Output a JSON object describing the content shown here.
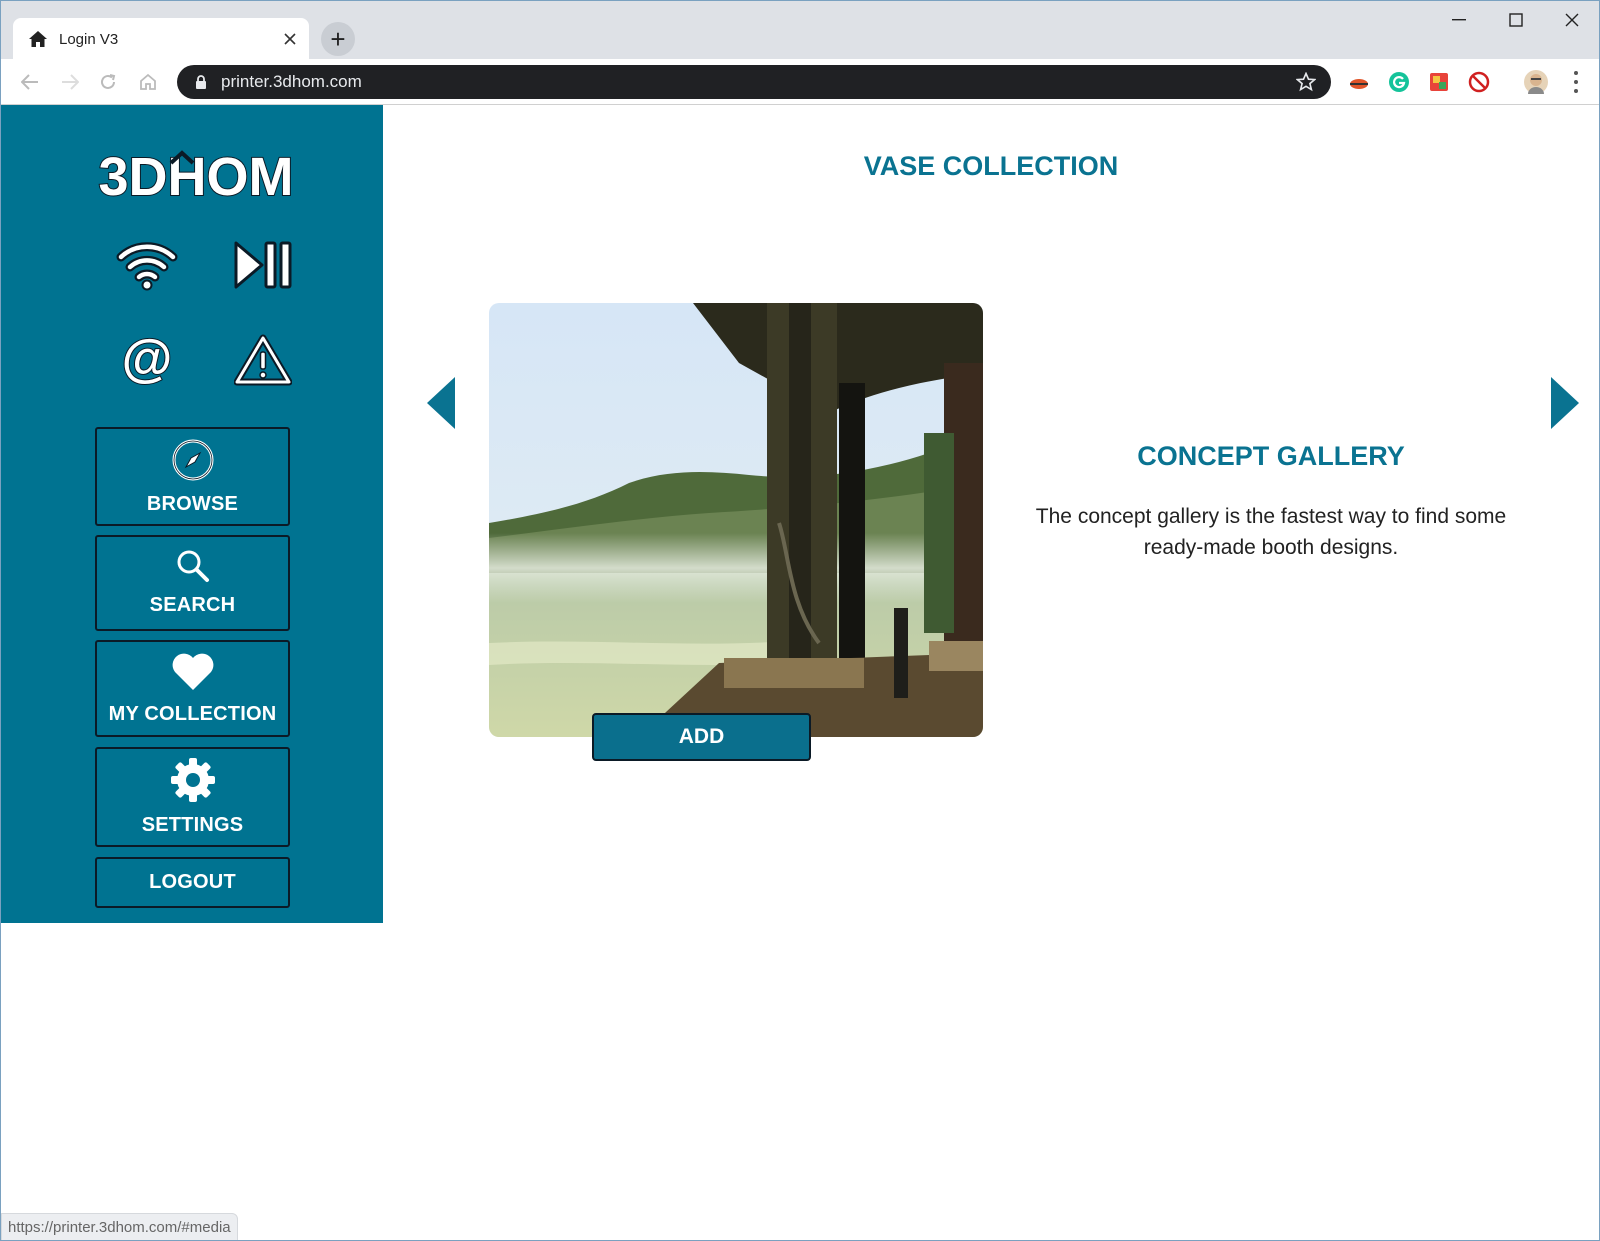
{
  "browser": {
    "tab_title": "Login V3",
    "tab_icon": "home-icon",
    "new_tab_label": "+",
    "url": "printer.3dhom.com",
    "status_url": "https://printer.3dhom.com/#media"
  },
  "sidebar": {
    "logo_text": "3DHOM",
    "status_icons": [
      "wifi-icon",
      "play-pause-icon",
      "at-icon",
      "warning-icon"
    ],
    "nav": {
      "browse": "BROWSE",
      "search": "SEARCH",
      "collection": "MY COLLECTION",
      "settings": "SETTINGS",
      "logout": "LOGOUT"
    }
  },
  "main": {
    "title": "VASE COLLECTION",
    "add_label": "ADD",
    "gallery_title": "CONCEPT GALLERY",
    "gallery_description": "The concept gallery is the fastest way to find some ready-made booth designs."
  },
  "colors": {
    "sidebar_bg": "#007391",
    "accent": "#0a7391",
    "button_bg": "#0a6f8d",
    "border_dark": "#0b1a26"
  }
}
